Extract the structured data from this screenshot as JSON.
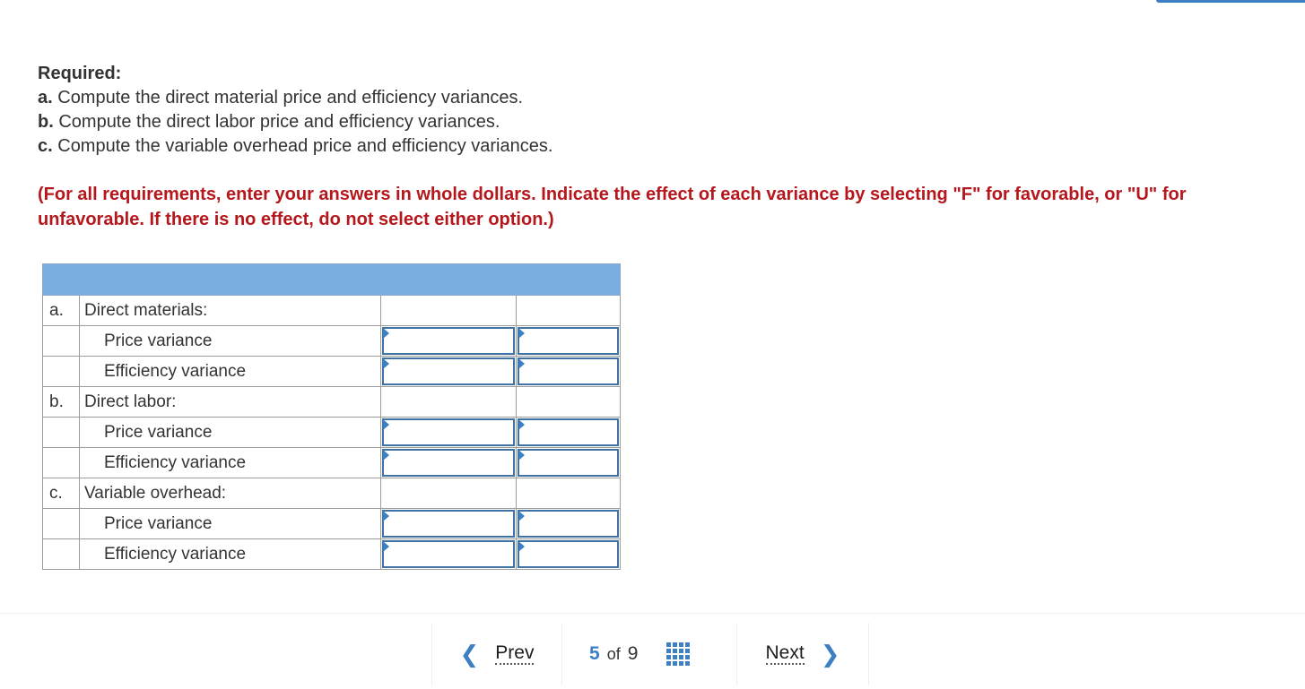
{
  "required": {
    "title": "Required:",
    "items": [
      {
        "lead": "a.",
        "text": " Compute the direct material price and efficiency variances."
      },
      {
        "lead": "b.",
        "text": " Compute the direct labor price and efficiency variances."
      },
      {
        "lead": "c.",
        "text": " Compute the variable overhead price and efficiency variances."
      }
    ]
  },
  "instructions": "(For all requirements, enter your answers in whole dollars. Indicate the effect of each variance by selecting \"F\" for favorable, or \"U\" for unfavorable. If there is no effect, do not select either option.)",
  "table": {
    "rows": [
      {
        "letter": "a.",
        "label": "Direct materials:"
      },
      {
        "letter": "",
        "label": "Price variance",
        "amount": "",
        "effect": ""
      },
      {
        "letter": "",
        "label": "Efficiency variance",
        "amount": "",
        "effect": ""
      },
      {
        "letter": "b.",
        "label": "Direct labor:"
      },
      {
        "letter": "",
        "label": "Price variance",
        "amount": "",
        "effect": ""
      },
      {
        "letter": "",
        "label": "Efficiency variance",
        "amount": "",
        "effect": ""
      },
      {
        "letter": "c.",
        "label": "Variable overhead:"
      },
      {
        "letter": "",
        "label": "Price variance",
        "amount": "",
        "effect": ""
      },
      {
        "letter": "",
        "label": "Efficiency variance",
        "amount": "",
        "effect": ""
      }
    ]
  },
  "nav": {
    "prev_label": "Prev",
    "next_label": "Next",
    "current_page": "5",
    "of_label": "of",
    "total_pages": "9",
    "prev_icon": "chevron-left-icon",
    "next_icon": "chevron-right-icon",
    "grid_icon": "grid-icon"
  },
  "colors": {
    "accent": "#3d7fc3",
    "instruction_red": "#b5171c",
    "table_header": "#7aaee3"
  }
}
